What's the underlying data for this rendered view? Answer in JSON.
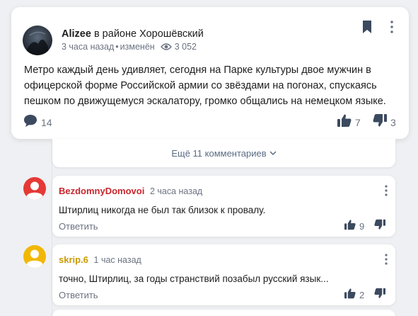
{
  "post": {
    "author": "Alizee",
    "location": "в районе Хорошёвский",
    "time": "3 часа назад",
    "edited": "изменён",
    "separator": "•",
    "views": "3 052",
    "text": "Метро каждый день удивляет, сегодня на Парке культуры двое мужчин в офицерской форме Российской армии со звёздами на погонах, спускаясь пешком по движущемуся эскалатору, громко общались на немецком языке.",
    "comments_count": "14",
    "likes": "7",
    "dislikes": "3",
    "icons": {
      "bookmark": "bookmark-icon",
      "menu": "more-vertical-icon",
      "views": "eye-icon",
      "comments": "speech-bubble-icon",
      "like": "thumbs-up-icon",
      "dislike": "thumbs-down-icon"
    }
  },
  "more_comments": {
    "label": "Ещё 11 комментариев",
    "icon": "chevron-down-icon"
  },
  "comments": [
    {
      "author": "BezdomnyDomovoi",
      "author_color": "#c8262c",
      "avatar_color": "#e53935",
      "time": "2 часа назад",
      "text": "Штирлиц никогда не был так близок к провалу.",
      "reply_label": "Ответить",
      "likes": "9"
    },
    {
      "author": "skrip.6",
      "author_color": "#c99a00",
      "avatar_color": "#f2b705",
      "time": "1 час назад",
      "text": "точно, Штирлиц, за годы странствий позабыл русский язык...",
      "reply_label": "Ответить",
      "likes": "2"
    }
  ],
  "colors": {
    "background": "#eef0f3",
    "card": "#ffffff",
    "author_blue": "#1d1d1f",
    "meta_gray": "#6b7381",
    "link_blue": "#5a6b84",
    "icon_dark": "#3c4a5f"
  }
}
